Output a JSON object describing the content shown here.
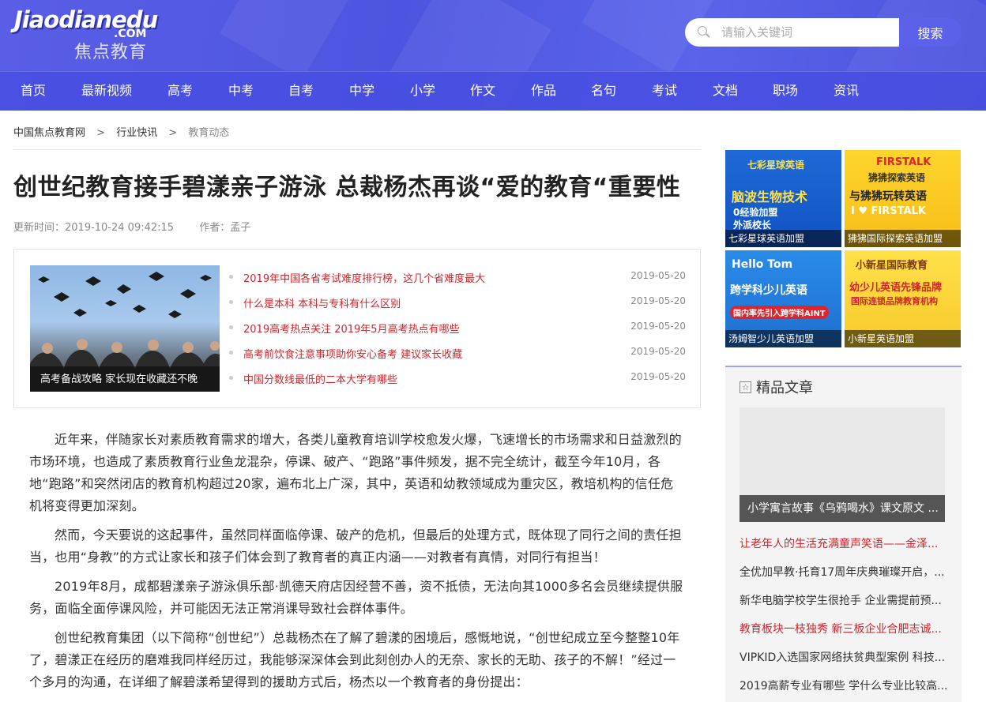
{
  "header": {
    "logo_main": "Jiaodianedu",
    "logo_com": ".COM",
    "logo_cn": "焦点教育",
    "search_placeholder": "请输入关键词",
    "search_button": "搜索"
  },
  "nav": [
    "首页",
    "最新视频",
    "高考",
    "中考",
    "自考",
    "中学",
    "小学",
    "作文",
    "作品",
    "名句",
    "考试",
    "文档",
    "职场",
    "资讯"
  ],
  "breadcrumb": [
    "中国焦点教育网",
    "行业快讯",
    "教育动态"
  ],
  "breadcrumb_sep": ">",
  "article": {
    "title": "创世纪教育接手碧漾亲子游泳 总裁杨杰再谈“爱的教育“重要性",
    "updated": "更新时间：2019-10-24 09:42:15",
    "author": "作者：孟子",
    "paragraphs": [
      "近年来，伴随家长对素质教育需求的增大，各类儿童教育培训学校愈发火爆，飞速增长的市场需求和日益激烈的市场环境，也造成了素质教育行业鱼龙混杂，停课、破产、“跑路”事件频发，据不完全统计，截至今年10月，各地“跑路”和突然闭店的教育机构超过20家，遍布北上广深，其中，英语和幼教领域成为重灾区，教培机构的信任危机将变得更加深刻。",
      "然而，今天要说的这起事件，虽然同样面临停课、破产的危机，但最后的处理方式，既体现了同行之间的责任担当，也用“身教”的方式让家长和孩子们体会到了教育者的真正内涵——对教者有真情，对同行有担当！",
      "2019年8月，成都碧漾亲子游泳俱乐部·凯德天府店因经营不善，资不抵债，无法向其1000多名会员继续提供服务，面临全面停课风险，并可能因无法正常消课导致社会群体事件。",
      "创世纪教育集团（以下简称“创世纪”）总裁杨杰在了解了碧漾的困境后，感慨地说，“创世纪成立至今整整10年了，碧漾正在经历的磨难我同样经历过，我能够深深体会到此刻创办人的无奈、家长的无助、孩子的不解！”经过一个多月的沟通，在详细了解碧漾希望得到的援助方式后，杨杰以一个教育者的身份提出："
    ]
  },
  "related": {
    "image_caption": "高考备战攻略 家长现在收藏还不晚",
    "items": [
      {
        "title": "2019年中国各省考试难度排行榜，这几个省难度最大",
        "date": "2019-05-20"
      },
      {
        "title": "什么是本科 本科与专科有什么区别",
        "date": "2019-05-20"
      },
      {
        "title": "2019高考热点关注 2019年5月高考热点有哪些",
        "date": "2019-05-20"
      },
      {
        "title": "高考前饮食注意事项助你安心备考 建议家长收藏",
        "date": "2019-05-20"
      },
      {
        "title": "中国分数线最低的二本大学有哪些",
        "date": "2019-05-20"
      }
    ]
  },
  "ads": [
    {
      "brand": "七彩星球英语",
      "line1": "脑波生物技术",
      "line2": "0经验加盟",
      "line3": "外派校长",
      "caption": "七彩星球英语加盟"
    },
    {
      "brand": "FIRSTALK",
      "line1": "狒狒探索英语",
      "line2": "与狒狒玩转英语",
      "line3": "I ♥ FIRSTALK",
      "caption": "狒狒国际探索英语加盟"
    },
    {
      "brand": "Hello Tom",
      "line1": "跨学科少儿英语",
      "line2": "国内率先引入跨学科AINT",
      "line3": "",
      "caption": "汤姆智少儿英语加盟"
    },
    {
      "brand": "小新星国际教育",
      "line1": "幼少儿英语先锋品牌",
      "line2": "国际连锁品牌教育机构",
      "line3": "",
      "caption": "小新星英语加盟"
    }
  ],
  "sidebar": {
    "panel_title": "精品文章",
    "featured_caption": "小学寓言故事《乌鸦喝水》课文原文 ...",
    "items": [
      {
        "text": "让老年人的生活充满童声笑语——金泽...",
        "red": true
      },
      {
        "text": "全优加早教·托育17周年庆典璀璨开启，...",
        "red": false
      },
      {
        "text": "新华电脑学校学生很抢手 企业需提前预...",
        "red": false
      },
      {
        "text": "教育板块一枝独秀 新三板企业合肥志诚...",
        "red": true
      },
      {
        "text": "VIPKID入选国家网络扶贫典型案例 科技...",
        "red": false
      },
      {
        "text": "2019高薪专业有哪些 学什么专业比较高...",
        "red": false
      }
    ]
  },
  "colors": {
    "header_blue": "#5257e4",
    "link_red": "#d0242b",
    "search_button": "#5b61e8"
  }
}
